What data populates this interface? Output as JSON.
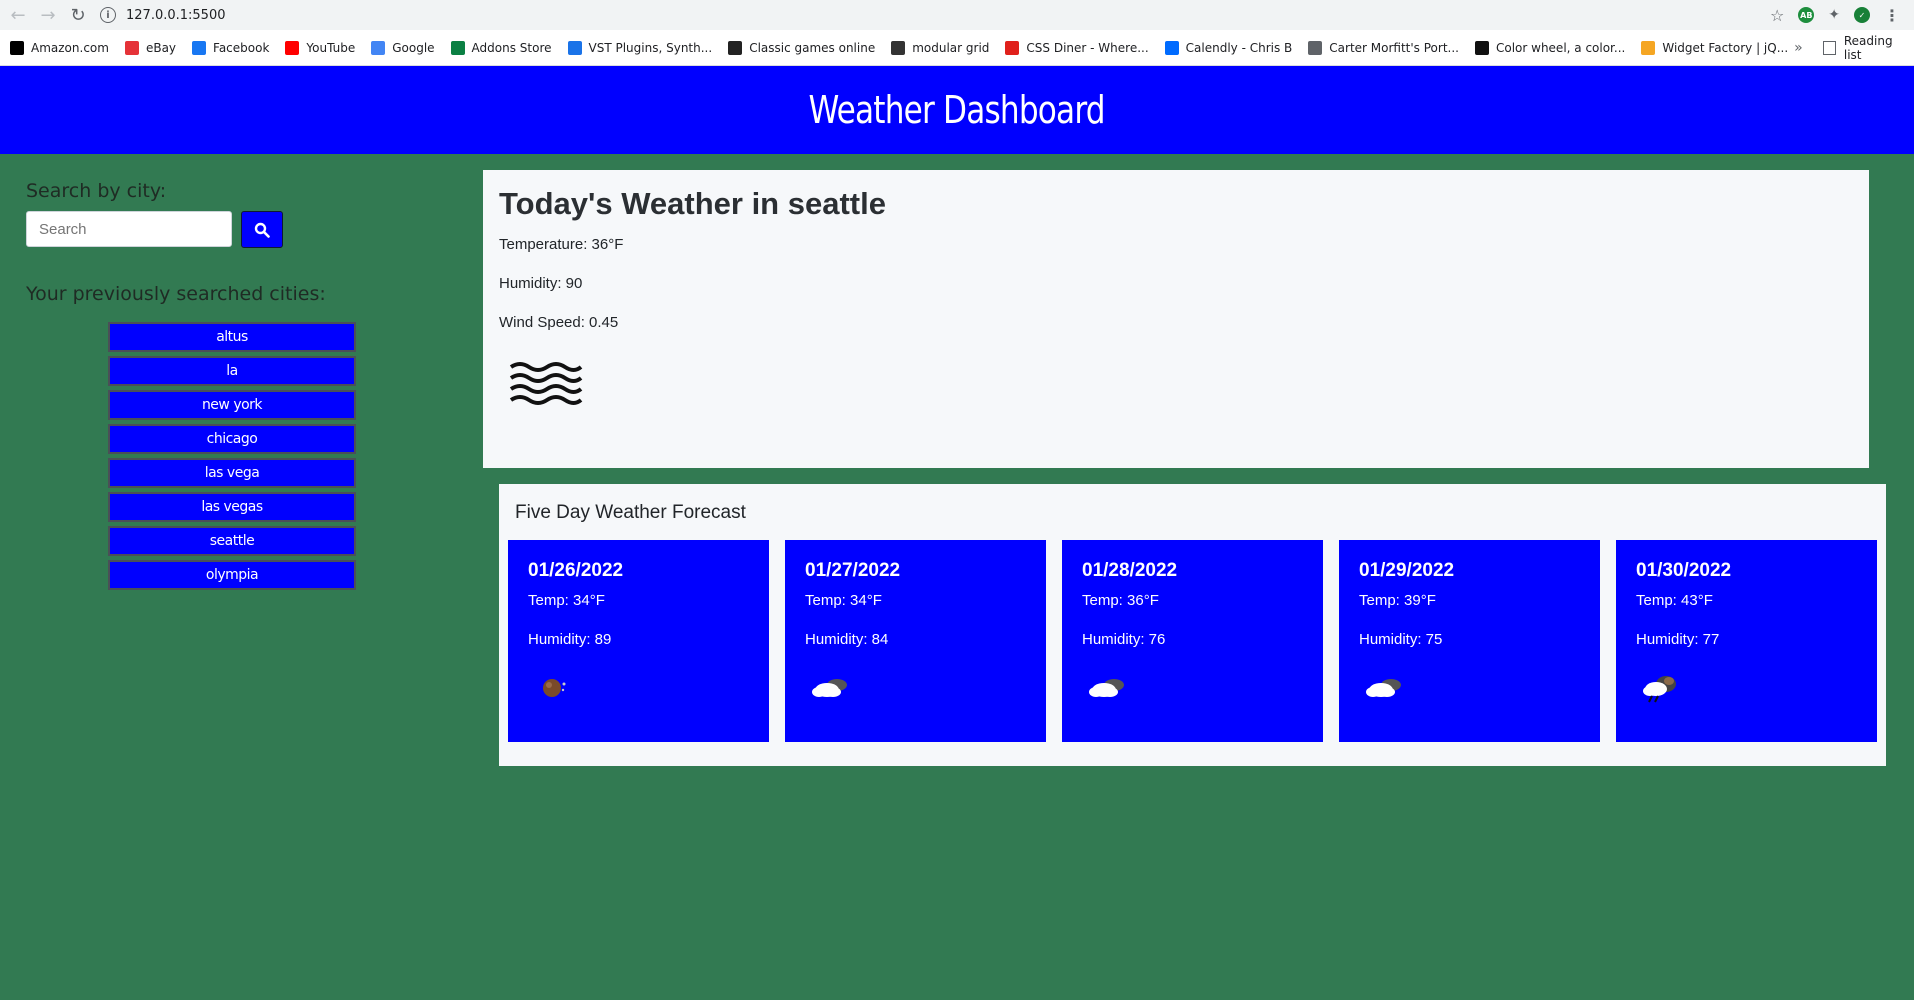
{
  "browser": {
    "url": "127.0.0.1:5500",
    "bookmarks": [
      {
        "label": "Amazon.com",
        "icon": "amazon-icon",
        "color": "#000000"
      },
      {
        "label": "eBay",
        "icon": "ebay-icon",
        "color": "#e53238"
      },
      {
        "label": "Facebook",
        "icon": "facebook-icon",
        "color": "#1877f2"
      },
      {
        "label": "YouTube",
        "icon": "youtube-icon",
        "color": "#ff0000"
      },
      {
        "label": "Google",
        "icon": "google-icon",
        "color": "#4285f4"
      },
      {
        "label": "Addons Store",
        "icon": "addons-icon",
        "color": "#0b8043"
      },
      {
        "label": "VST Plugins, Synth...",
        "icon": "vst-icon",
        "color": "#1a73e8"
      },
      {
        "label": "Classic games online",
        "icon": "games-icon",
        "color": "#222222"
      },
      {
        "label": "modular grid",
        "icon": "modulargrid-icon",
        "color": "#333333"
      },
      {
        "label": "CSS Diner - Where...",
        "icon": "cssdiner-icon",
        "color": "#e0201b"
      },
      {
        "label": "Calendly - Chris B",
        "icon": "calendly-icon",
        "color": "#006bff"
      },
      {
        "label": "Carter Morfitt's Port...",
        "icon": "globe-icon",
        "color": "#5f6368"
      },
      {
        "label": "Color wheel, a color...",
        "icon": "colorwheel-icon",
        "color": "#111111"
      },
      {
        "label": "Widget Factory | jQ...",
        "icon": "jquery-icon",
        "color": "#f5a623"
      }
    ],
    "more": "»",
    "reading_list": "Reading list"
  },
  "header": {
    "title": "Weather Dashboard",
    "bg": "#0000ff"
  },
  "search": {
    "label": "Search by city:",
    "placeholder": "Search",
    "button_icon": "search-icon"
  },
  "history": {
    "label": "Your previously searched cities:",
    "cities": [
      "altus",
      "la",
      "new york",
      "chicago",
      "las vega",
      "las vegas",
      "seattle",
      "olympia"
    ]
  },
  "today": {
    "title": "Today's Weather in seattle",
    "temperature": "Temperature: 36°F",
    "humidity": "Humidity: 90",
    "wind": "Wind Speed: 0.45",
    "icon": "mist-icon"
  },
  "forecast": {
    "title": "Five Day Weather Forecast",
    "days": [
      {
        "date": "01/26/2022",
        "temp": "Temp: 34°F",
        "humidity": "Humidity: 89",
        "icon": "night-clear-icon"
      },
      {
        "date": "01/27/2022",
        "temp": "Temp: 34°F",
        "humidity": "Humidity: 84",
        "icon": "broken-clouds-icon"
      },
      {
        "date": "01/28/2022",
        "temp": "Temp: 36°F",
        "humidity": "Humidity: 76",
        "icon": "broken-clouds-icon"
      },
      {
        "date": "01/29/2022",
        "temp": "Temp: 39°F",
        "humidity": "Humidity: 75",
        "icon": "broken-clouds-icon"
      },
      {
        "date": "01/30/2022",
        "temp": "Temp: 43°F",
        "humidity": "Humidity: 77",
        "icon": "rain-clouds-icon"
      }
    ]
  },
  "colors": {
    "page_bg": "#327a52",
    "accent": "#0000ff",
    "panel_bg": "#f6f8fa"
  }
}
